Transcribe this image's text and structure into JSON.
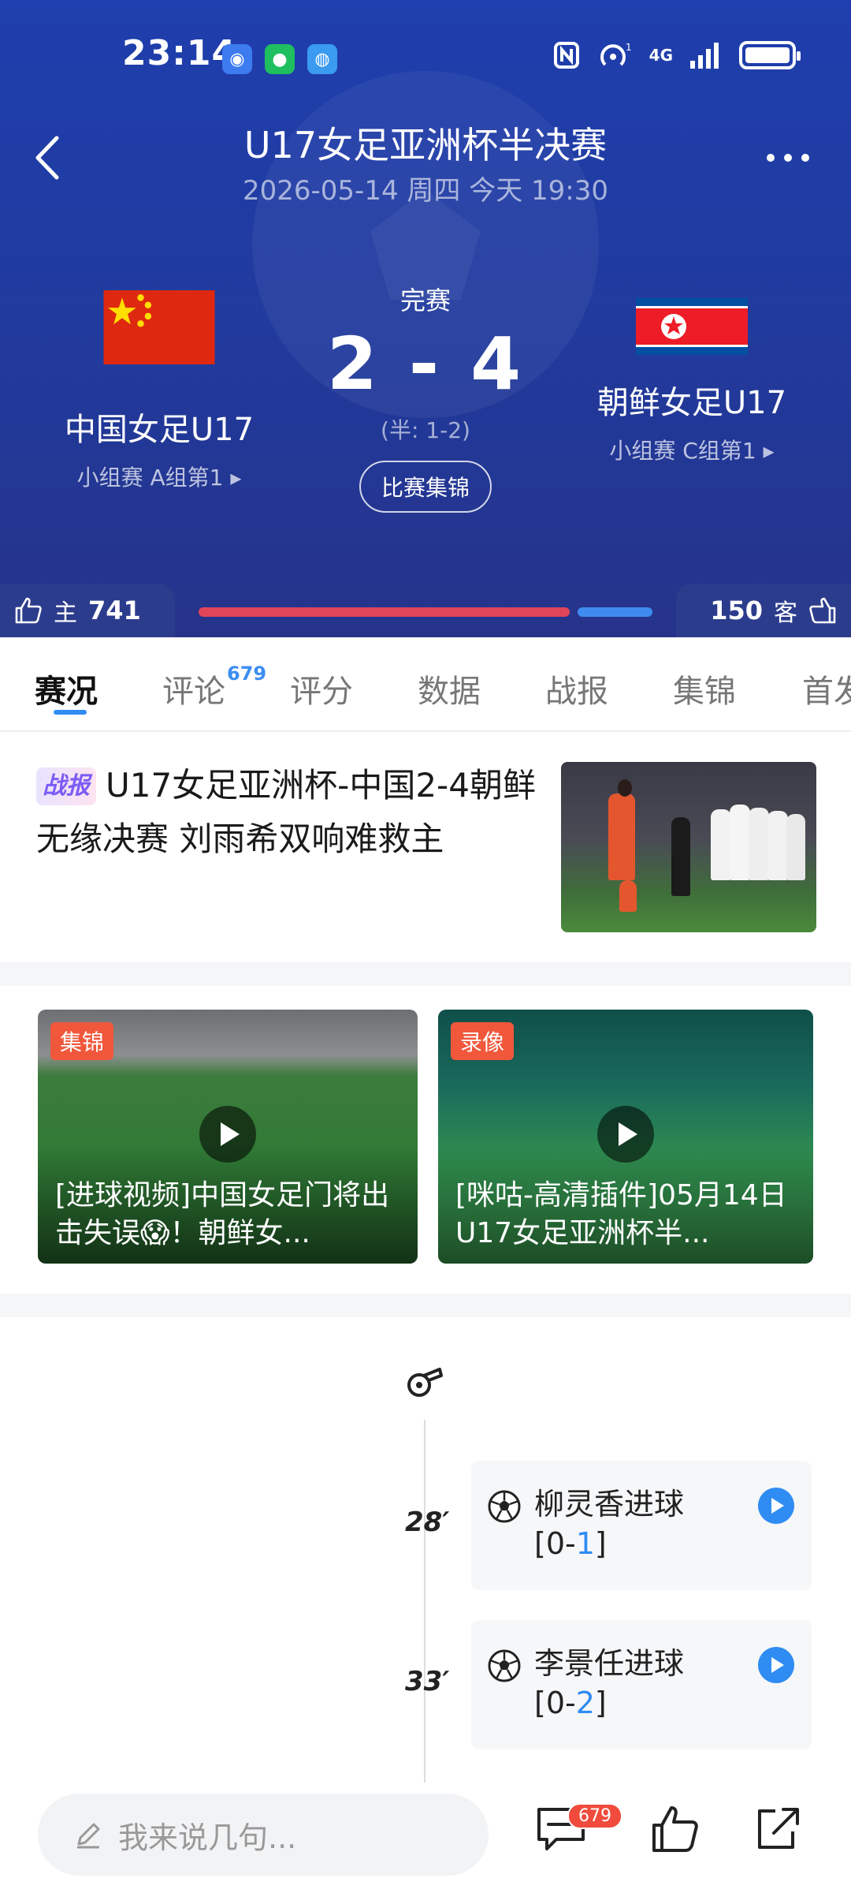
{
  "status_bar": {
    "time": "23:14",
    "network": "4G",
    "sim_slot": "1",
    "icons": [
      "security-app-icon",
      "wechat-icon",
      "browser-icon",
      "nfc-icon",
      "hotspot-icon",
      "signal-icon",
      "battery-icon"
    ]
  },
  "header": {
    "title": "U17女足亚洲杯半决赛",
    "subtitle": "2026-05-14 周四 今天 19:30"
  },
  "match": {
    "status": "完赛",
    "score": "2 - 4",
    "half_time": "(半: 1-2)",
    "highlights_button": "比赛集锦",
    "home": {
      "name": "中国女足U17",
      "rank": "小组赛 A组第1",
      "flag": "china-flag"
    },
    "away": {
      "name": "朝鲜女足U17",
      "rank": "小组赛 C组第1",
      "flag": "north-korea-flag"
    }
  },
  "votes": {
    "home_label": "主",
    "home_count": "741",
    "away_label": "客",
    "away_count": "150",
    "home_color": "#e0455a",
    "away_color": "#3f8cf0"
  },
  "tabs": [
    {
      "label": "赛况",
      "active": true
    },
    {
      "label": "评论",
      "badge": "679"
    },
    {
      "label": "评分"
    },
    {
      "label": "数据"
    },
    {
      "label": "战报"
    },
    {
      "label": "集锦"
    },
    {
      "label": "首发"
    }
  ],
  "news": {
    "tag": "战报",
    "headline": "U17女足亚洲杯-中国2-4朝鲜无缘决赛 刘雨希双响难救主"
  },
  "videos": [
    {
      "badge": "集锦",
      "title": "[进球视频]中国女足门将出击失误😱！朝鲜女..."
    },
    {
      "badge": "录像",
      "title": "[咪咕-高清插件]05月14日 U17女足亚洲杯半..."
    }
  ],
  "events": [
    {
      "minute": "28′",
      "text": "柳灵香进球",
      "score_prefix": "[0-",
      "score_goal": "1",
      "score_suffix": "]"
    },
    {
      "minute": "33′",
      "text": "李景任进球",
      "score_prefix": "[0-",
      "score_goal": "2",
      "score_suffix": "]"
    }
  ],
  "bottom_bar": {
    "comment_placeholder": "我来说几句...",
    "comment_count": "679"
  },
  "colors": {
    "header_blue": "#2140a8",
    "accent_blue": "#2f8cf2",
    "badge_red": "#f04b3c"
  }
}
